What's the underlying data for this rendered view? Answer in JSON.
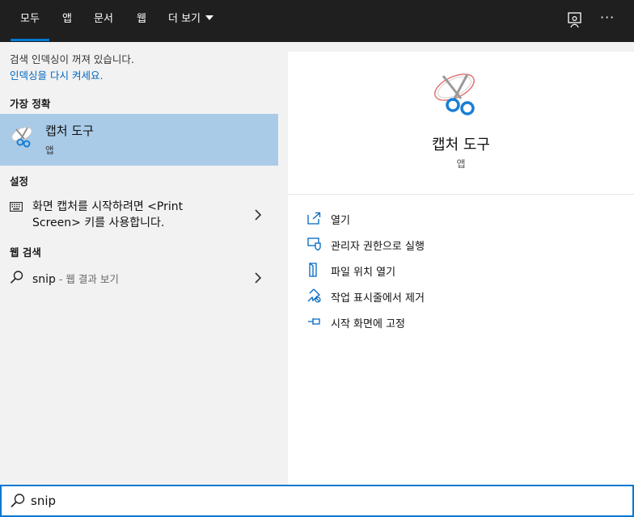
{
  "tabs": [
    {
      "label": "모두"
    },
    {
      "label": "앱"
    },
    {
      "label": "문서"
    },
    {
      "label": "웹"
    },
    {
      "label": "더 보기"
    }
  ],
  "header_icons": {
    "feedback": "feedback-icon",
    "more": "···"
  },
  "left": {
    "notice": "검색 인덱싱이 꺼져 있습니다.",
    "notice_link": "인덱싱을 다시 켜세요.",
    "best_match_header": "가장 정확",
    "best_match": {
      "title": "캡처 도구",
      "subtitle": "앱",
      "icon": "snipping-tool-icon"
    },
    "settings_header": "설정",
    "setting_item": {
      "text": "화면 캡처를 시작하려면 <Print Screen> 키를 사용합니다.",
      "icon": "keyboard-icon"
    },
    "web_header": "웹 검색",
    "web_item": {
      "query": "snip",
      "suffix": " - 웹 결과 보기",
      "icon": "search-icon"
    }
  },
  "right": {
    "app_title": "캡처 도구",
    "app_subtitle": "앱",
    "actions": [
      {
        "label": "열기",
        "icon": "open-icon"
      },
      {
        "label": "관리자 권한으로 실행",
        "icon": "run-as-admin-icon"
      },
      {
        "label": "파일 위치 열기",
        "icon": "file-location-icon"
      },
      {
        "label": "작업 표시줄에서 제거",
        "icon": "unpin-taskbar-icon"
      },
      {
        "label": "시작 화면에 고정",
        "icon": "pin-start-icon"
      }
    ]
  },
  "search": {
    "value": "snip",
    "icon": "search-icon"
  },
  "colors": {
    "accent": "#0078d4",
    "selected": "#a9cbe8",
    "topbar": "#1f1f1f",
    "link": "#0067c0"
  }
}
